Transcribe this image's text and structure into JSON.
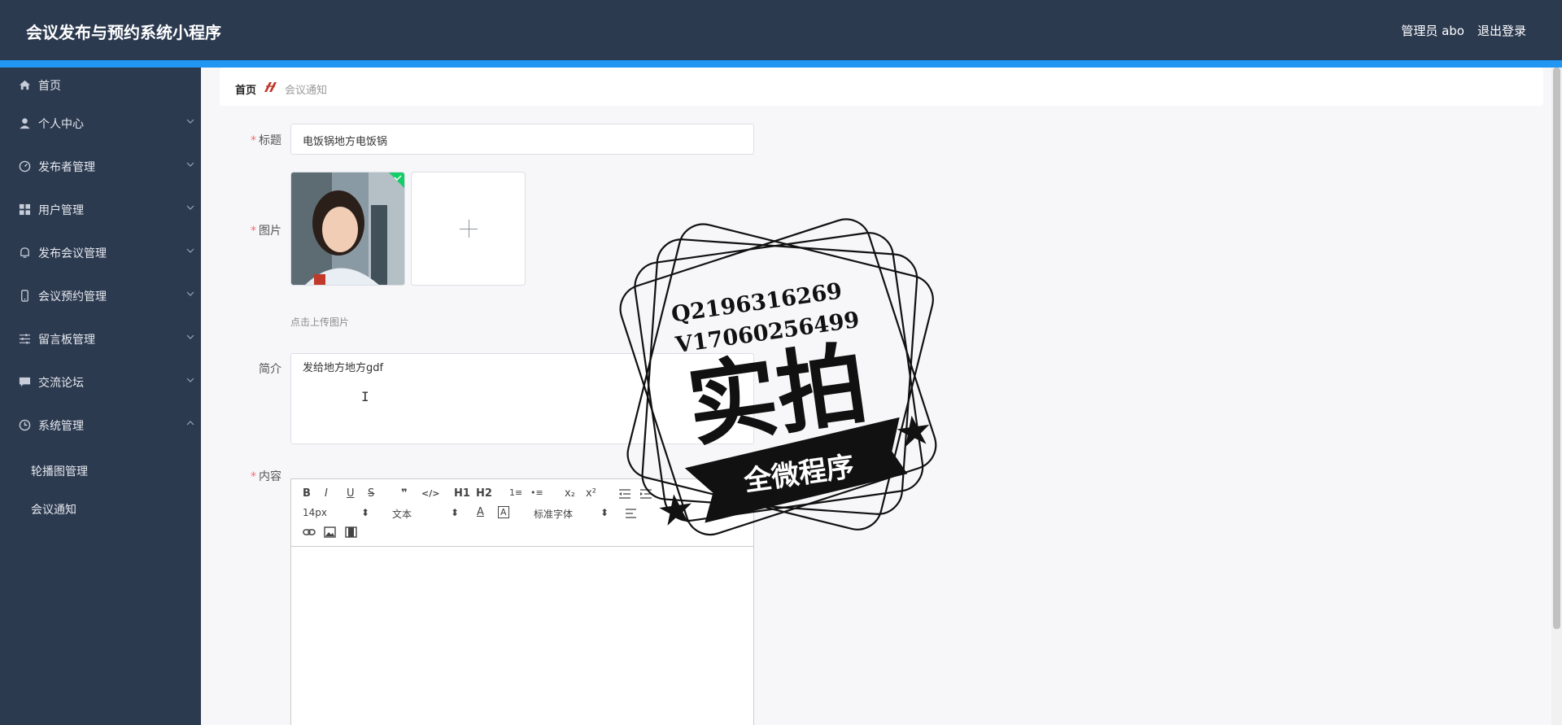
{
  "header": {
    "title": "会议发布与预约系统小程序",
    "user": "管理员 abo",
    "logout": "退出登录"
  },
  "sidebar": {
    "items": [
      {
        "label": "首页",
        "icon": "home-icon"
      },
      {
        "label": "个人中心",
        "icon": "user-icon"
      },
      {
        "label": "发布者管理",
        "icon": "dashboard-icon"
      },
      {
        "label": "用户管理",
        "icon": "grid-icon"
      },
      {
        "label": "发布会议管理",
        "icon": "bell-icon"
      },
      {
        "label": "会议预约管理",
        "icon": "phone-icon"
      },
      {
        "label": "留言板管理",
        "icon": "sliders-icon"
      },
      {
        "label": "交流论坛",
        "icon": "chat-icon"
      },
      {
        "label": "系统管理",
        "icon": "clock-icon"
      }
    ],
    "sub_items": [
      "轮播图管理",
      "会议通知"
    ]
  },
  "breadcrumb": {
    "home": "首页",
    "current": "会议通知"
  },
  "form": {
    "title_label": "标题",
    "title_value": "电饭锅地方电饭锅",
    "image_label": "图片",
    "upload_hint": "点击上传图片",
    "intro_label": "简介",
    "intro_value": "发给地方地方gdf",
    "content_label": "内容"
  },
  "editor": {
    "toolbar_row1": [
      "B",
      "I",
      "U",
      "S",
      "❞",
      "</>",
      "H1",
      "H2",
      "1≡",
      "•≡",
      "x₂",
      "x²"
    ],
    "font_size": "14px",
    "block_type": "文本",
    "font_family": "标准字体"
  },
  "watermark": {
    "line1": "Q2196316269",
    "line2": "V17060256499",
    "main": "实拍",
    "ribbon": "全微程序"
  }
}
